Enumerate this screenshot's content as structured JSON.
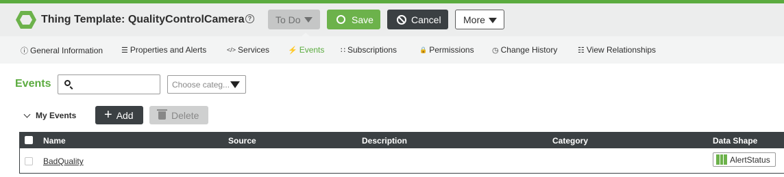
{
  "header": {
    "title": "Thing Template: QualityControlCamera",
    "help_glyph": "?",
    "todo_label": "To Do",
    "save_label": "Save",
    "cancel_label": "Cancel",
    "more_label": "More"
  },
  "tabs": [
    {
      "label": "General Information",
      "icon": "info-icon",
      "glyph": "ⓘ",
      "active": false
    },
    {
      "label": "Properties and Alerts",
      "icon": "list-icon",
      "glyph": "☰",
      "active": false
    },
    {
      "label": "Services",
      "icon": "code-icon",
      "glyph": "</>",
      "active": false
    },
    {
      "label": "Events",
      "icon": "lightning-icon",
      "glyph": "⚡",
      "active": true
    },
    {
      "label": "Subscriptions",
      "icon": "rss-icon",
      "glyph": "∷",
      "active": false
    },
    {
      "label": "Permissions",
      "icon": "lock-icon",
      "glyph": "🔒",
      "active": false
    },
    {
      "label": "Change History",
      "icon": "clock-icon",
      "glyph": "◷",
      "active": false
    },
    {
      "label": "View Relationships",
      "icon": "hierarchy-icon",
      "glyph": "☷",
      "active": false
    }
  ],
  "events_panel": {
    "title": "Events",
    "search": {
      "value": "",
      "placeholder": ""
    },
    "category_placeholder": "Choose categ...",
    "section_label": "My Events",
    "add_label": "Add",
    "delete_label": "Delete"
  },
  "table": {
    "columns": [
      "Name",
      "Source",
      "Description",
      "Category",
      "Data Shape"
    ],
    "rows": [
      {
        "name": "BadQuality",
        "source": "",
        "description": "",
        "category": "",
        "data_shape": "AlertStatus"
      }
    ]
  },
  "colors": {
    "accent_green": "#5bab3f",
    "save_green": "#6cb24b",
    "dark": "#3b4043"
  }
}
